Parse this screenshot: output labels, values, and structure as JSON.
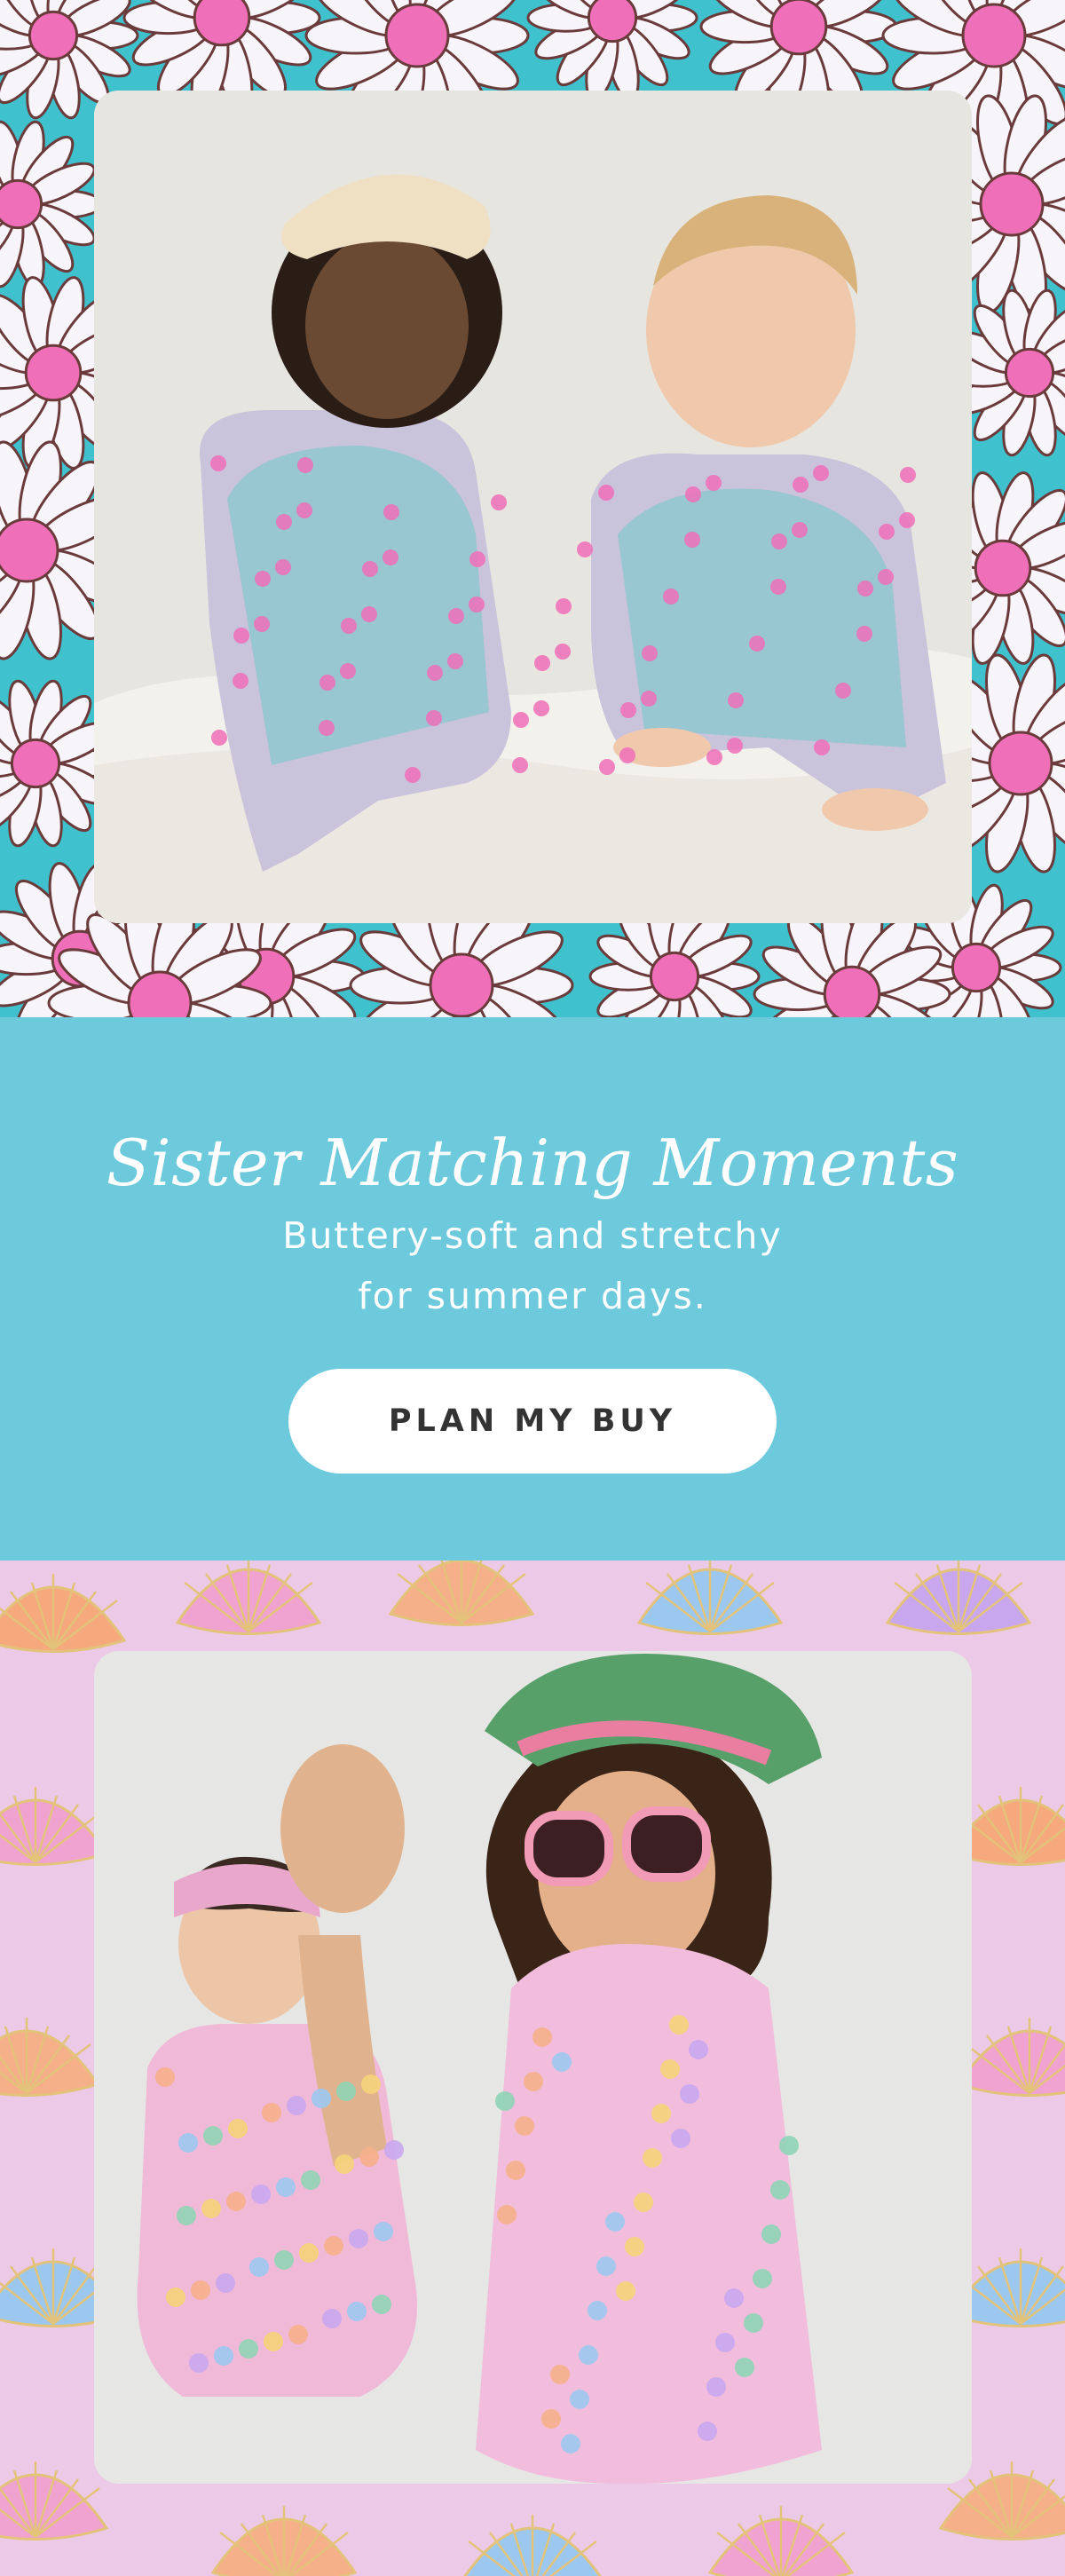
{
  "hero": {
    "headline": "Sister Matching Moments",
    "subtext_line1": "Buttery-soft and stretchy",
    "subtext_line2": "for summer days.",
    "cta_label": "PLAN MY BUY"
  },
  "colors": {
    "teal_background": "#6ccadc",
    "daisy_teal": "#3fc2cd",
    "daisy_pink": "#ef6fb8",
    "shell_pink": "#ecc9e6",
    "button_bg": "#ffffff",
    "button_text": "#333333"
  },
  "images": {
    "top_photo": "two-children-daisy-pajamas-photo",
    "bottom_photo": "two-girls-seashell-dresses-photo"
  }
}
